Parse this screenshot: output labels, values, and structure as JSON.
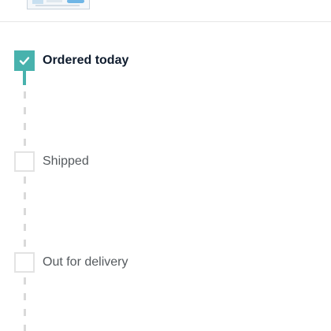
{
  "tracker": {
    "steps": [
      {
        "label": "Ordered today",
        "status": "complete"
      },
      {
        "label": "Shipped",
        "status": "pending"
      },
      {
        "label": "Out for delivery",
        "status": "pending"
      }
    ]
  },
  "colors": {
    "complete_accent": "#48b2ad",
    "pending_border": "#e3e3e3",
    "active_text": "#0f1c2e",
    "inactive_text": "#555a5e",
    "dash": "#d9d9d9"
  },
  "icons": {
    "complete": "check-icon"
  }
}
